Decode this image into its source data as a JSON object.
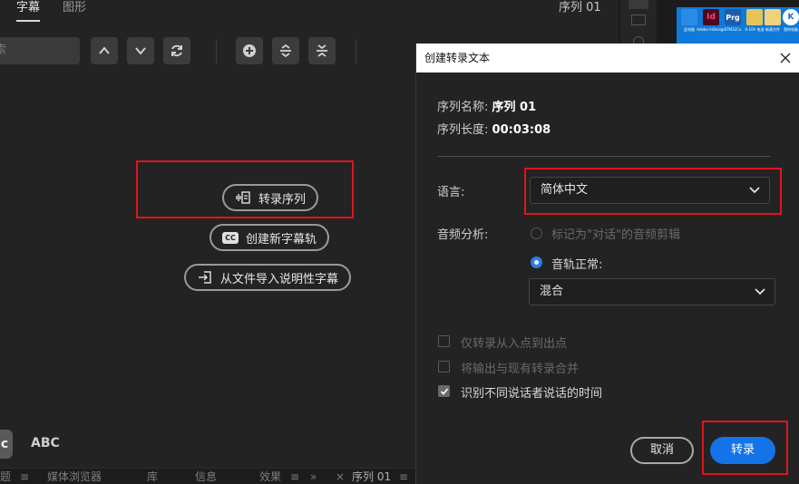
{
  "tabs": [
    {
      "label": "字幕"
    },
    {
      "label": "图形"
    }
  ],
  "sequence_name_top": "序列 01",
  "search": {
    "placeholder": "索"
  },
  "actions": {
    "transcribe": "转录序列",
    "new_track": "创建新字幕轨",
    "import_file": "从文件导入说明性字幕",
    "cc_icon_text": "CC"
  },
  "abc_label": "ABC",
  "c_label": "c",
  "bottom_tabs": [
    "题",
    "媒体浏览器",
    "库",
    "信息",
    "效果",
    "序列 01"
  ],
  "bottom_more": "»",
  "bottom_close": "×",
  "desktop_icons": [
    {
      "glyph": "",
      "label": "此电脑",
      "color": "#2a8be6"
    },
    {
      "glyph": "Id",
      "label": "Adobe InDesign",
      "color": "#4a0a1e"
    },
    {
      "glyph": "Prg",
      "label": "STM32Cu",
      "color": "#1d5ca8"
    },
    {
      "glyph": "",
      "label": "0-10V 电流",
      "color": "#e7c45a"
    },
    {
      "glyph": "",
      "label": "新建文件",
      "color": "#f0d27a"
    },
    {
      "glyph": "K",
      "label": "我的电脑",
      "color": "#1a6fd0"
    }
  ],
  "dialog": {
    "title": "创建转录文本",
    "seq_name_label": "序列名称:",
    "seq_name_value": "序列 01",
    "seq_len_label": "序列长度:",
    "seq_len_value": "00:03:08",
    "language_label": "语言:",
    "language_value": "简体中文",
    "audio_label": "音频分析:",
    "option_dialog_clips": "标记为\"对话\"的音频剪辑",
    "option_track": "音轨正常:",
    "mix_value": "混合",
    "check_in_out": "仅转录从入点到出点",
    "check_merge": "将输出与现有转录合并",
    "check_speakers": "识别不同说话者说话的时间",
    "cancel": "取消",
    "ok": "转录"
  },
  "colors": {
    "accent": "#1473e6",
    "highlight_box": "#e0141e"
  }
}
